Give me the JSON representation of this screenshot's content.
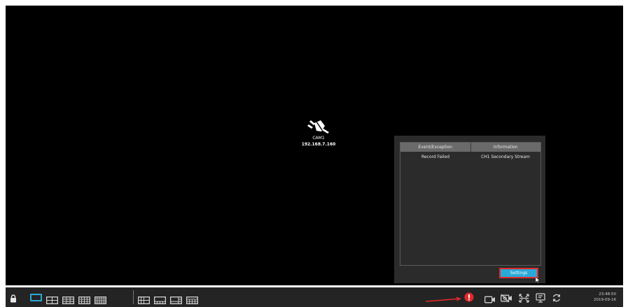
{
  "camera": {
    "name": "CAM1",
    "ip": "192.168.7.160",
    "status_icon": "disconnected-plug-icon"
  },
  "exception_panel": {
    "columns": [
      "Event/Exception",
      "Information"
    ],
    "rows": [
      {
        "event": "Record Failed",
        "information": "CH1 Secondary Stream"
      }
    ],
    "settings_label": "Settings"
  },
  "taskbar": {
    "lock_icon": "lock-icon",
    "layouts": [
      "1-view",
      "4-view",
      "9-view",
      "16-view",
      "25-view"
    ],
    "layouts_custom": [
      "6-view",
      "8-view",
      "8-view-alt",
      "custom-view"
    ],
    "active_layout": "1-view",
    "alert_icon": "alert-icon",
    "tools": [
      "record-icon",
      "hide-camera-icon",
      "fullscreen-icon",
      "display-icon",
      "refresh-icon"
    ],
    "time": "23:48:50",
    "date": "2019-09-16"
  },
  "colors": {
    "accent": "#2aa9d8",
    "alert": "#e22a2a",
    "annotation_arrow": "#e22a2a"
  }
}
